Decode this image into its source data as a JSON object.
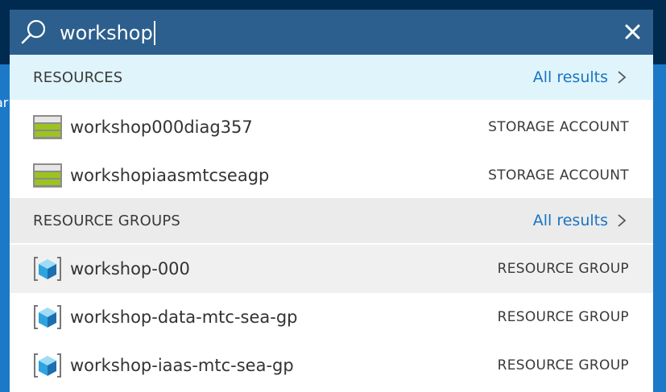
{
  "search": {
    "query": "workshop"
  },
  "sections": {
    "resources": {
      "title": "RESOURCES",
      "all_results": "All results",
      "items": [
        {
          "name": "workshop000diag357",
          "type": "STORAGE ACCOUNT",
          "icon": "storage-account-icon"
        },
        {
          "name": "workshopiaasmtcseagp",
          "type": "STORAGE ACCOUNT",
          "icon": "storage-account-icon"
        }
      ]
    },
    "resource_groups": {
      "title": "RESOURCE GROUPS",
      "all_results": "All results",
      "items": [
        {
          "name": "workshop-000",
          "type": "RESOURCE GROUP",
          "icon": "resource-group-icon"
        },
        {
          "name": "workshop-data-mtc-sea-gp",
          "type": "RESOURCE GROUP",
          "icon": "resource-group-icon"
        },
        {
          "name": "workshop-iaas-mtc-sea-gp",
          "type": "RESOURCE GROUP",
          "icon": "resource-group-icon"
        }
      ]
    }
  },
  "background": {
    "left_fragment": "ar"
  },
  "colors": {
    "searchbar": "#2c5f8d",
    "topbar": "#002a50",
    "accent_link": "#1874c2",
    "resources_header": "#e0f4fb",
    "groups_header": "#ebebeb",
    "row_highlight": "#f0f0f0"
  }
}
